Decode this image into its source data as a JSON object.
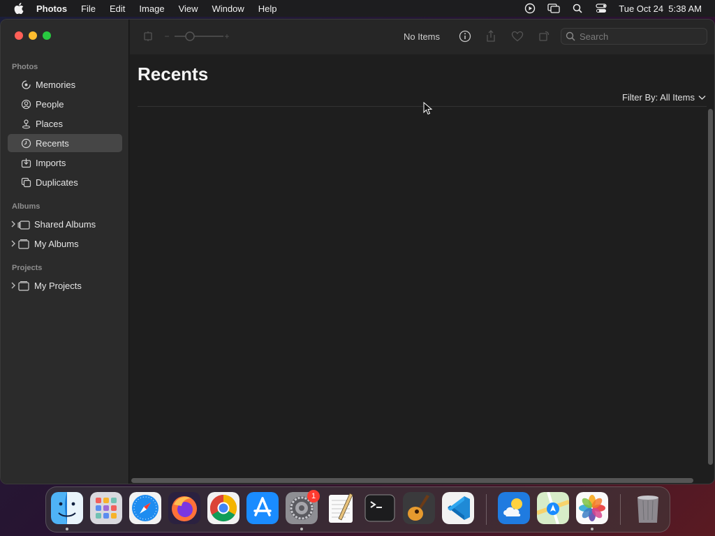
{
  "menubar": {
    "app_name": "Photos",
    "items": [
      "File",
      "Edit",
      "Image",
      "View",
      "Window",
      "Help"
    ],
    "datetime": "Tue Oct 24  5:38 AM"
  },
  "sidebar": {
    "sections": [
      {
        "title": "Photos",
        "items": [
          {
            "label": "Memories",
            "icon": "memories-icon"
          },
          {
            "label": "People",
            "icon": "person-icon"
          },
          {
            "label": "Places",
            "icon": "pin-icon"
          },
          {
            "label": "Recents",
            "icon": "clock-icon",
            "selected": true
          },
          {
            "label": "Imports",
            "icon": "import-icon"
          },
          {
            "label": "Duplicates",
            "icon": "duplicates-icon"
          }
        ]
      },
      {
        "title": "Albums",
        "items": [
          {
            "label": "Shared Albums",
            "icon": "shared-album-icon"
          },
          {
            "label": "My Albums",
            "icon": "folder-icon"
          }
        ]
      },
      {
        "title": "Projects",
        "items": [
          {
            "label": "My Projects",
            "icon": "folder-icon"
          }
        ]
      }
    ]
  },
  "toolbar": {
    "status": "No Items",
    "search_placeholder": "Search",
    "zoom_minus": "−",
    "zoom_plus": "+"
  },
  "main": {
    "title": "Recents",
    "filter_label": "Filter By: All Items"
  },
  "dock": {
    "apps": [
      "Finder",
      "Launchpad",
      "Safari",
      "Firefox",
      "Google Chrome",
      "App Store",
      "System Settings",
      "TextEdit",
      "Terminal",
      "GarageBand",
      "Visual Studio Code",
      "Weather",
      "Maps",
      "Photos",
      "Trash"
    ],
    "system_settings_badge": "1"
  },
  "colors": {
    "accent_selected": "#464646",
    "close": "#ff5f57",
    "minimize": "#febc2e",
    "maximize": "#28c840"
  }
}
